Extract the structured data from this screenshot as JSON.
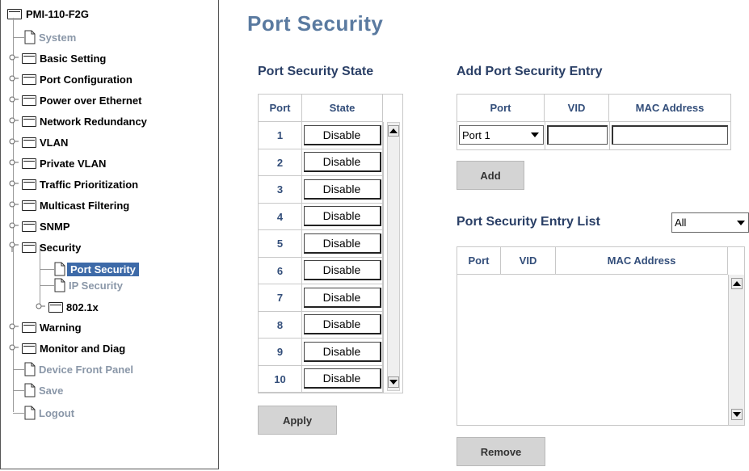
{
  "sidebar": {
    "root": "PMI-110-F2G",
    "items": [
      {
        "label": "System",
        "type": "page"
      },
      {
        "label": "Basic Setting",
        "type": "folder"
      },
      {
        "label": "Port Configuration",
        "type": "folder"
      },
      {
        "label": "Power over Ethernet",
        "type": "folder"
      },
      {
        "label": "Network Redundancy",
        "type": "folder"
      },
      {
        "label": "VLAN",
        "type": "folder"
      },
      {
        "label": "Private VLAN",
        "type": "folder"
      },
      {
        "label": "Traffic Prioritization",
        "type": "folder"
      },
      {
        "label": "Multicast Filtering",
        "type": "folder"
      },
      {
        "label": "SNMP",
        "type": "folder"
      },
      {
        "label": "Security",
        "type": "folder-open"
      },
      {
        "label": "Port Security",
        "type": "page",
        "selected": true
      },
      {
        "label": "IP Security",
        "type": "page"
      },
      {
        "label": "802.1x",
        "type": "folder"
      },
      {
        "label": "Warning",
        "type": "folder"
      },
      {
        "label": "Monitor and Diag",
        "type": "folder"
      },
      {
        "label": "Device Front Panel",
        "type": "page"
      },
      {
        "label": "Save",
        "type": "page"
      },
      {
        "label": "Logout",
        "type": "page"
      }
    ]
  },
  "page": {
    "title": "Port Security"
  },
  "state": {
    "heading": "Port Security State",
    "col_port": "Port",
    "col_state": "State",
    "rows": [
      {
        "port": "1",
        "state": "Disable"
      },
      {
        "port": "2",
        "state": "Disable"
      },
      {
        "port": "3",
        "state": "Disable"
      },
      {
        "port": "4",
        "state": "Disable"
      },
      {
        "port": "5",
        "state": "Disable"
      },
      {
        "port": "6",
        "state": "Disable"
      },
      {
        "port": "7",
        "state": "Disable"
      },
      {
        "port": "8",
        "state": "Disable"
      },
      {
        "port": "9",
        "state": "Disable"
      },
      {
        "port": "10",
        "state": "Disable"
      }
    ],
    "apply_label": "Apply"
  },
  "add_entry": {
    "heading": "Add Port Security Entry",
    "col_port": "Port",
    "col_vid": "VID",
    "col_mac": "MAC Address",
    "port_value": "Port 1",
    "vid_value": "",
    "mac_value": "",
    "add_label": "Add"
  },
  "entry_list": {
    "heading": "Port Security Entry List",
    "filter_value": "All",
    "col_port": "Port",
    "col_vid": "VID",
    "col_mac": "MAC Address",
    "remove_label": "Remove"
  }
}
